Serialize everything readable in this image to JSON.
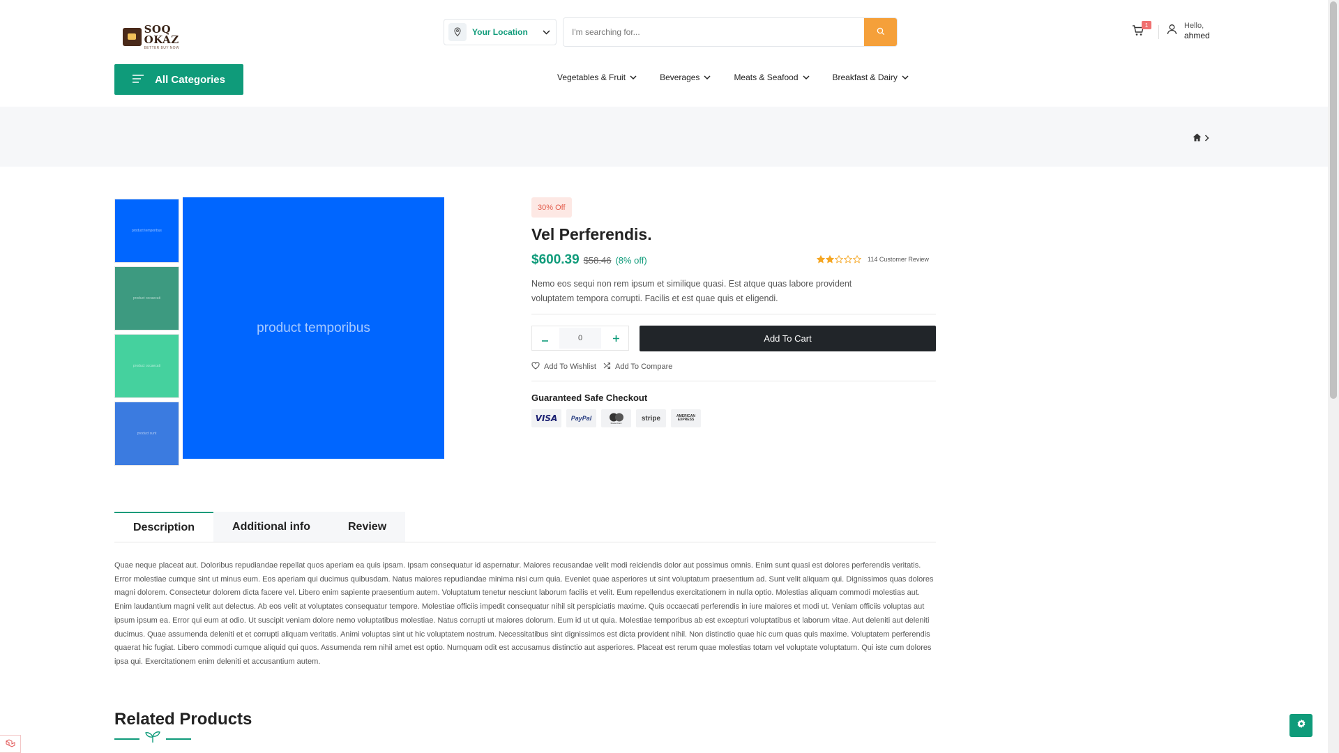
{
  "header": {
    "logo": {
      "name": "SOQ OKAZ",
      "tagline": "BETTER BUY NOW"
    },
    "location_label": "Your Location",
    "search_placeholder": "I'm searching for...",
    "cart_count": "1",
    "user": {
      "greeting": "Hello,",
      "name": "ahmed"
    },
    "all_categories_label": "All Categories",
    "nav": [
      {
        "label": "Vegetables & Fruit"
      },
      {
        "label": "Beverages"
      },
      {
        "label": "Meats & Seafood"
      },
      {
        "label": "Breakfast & Dairy"
      }
    ]
  },
  "gallery": {
    "thumbnails": [
      {
        "label": "product temporibus",
        "color": "#0066ff"
      },
      {
        "label": "product occaecati",
        "color": "#3d9a80"
      },
      {
        "label": "product occaecati",
        "color": "#45d19e"
      },
      {
        "label": "product sunt",
        "color": "#3b7be0"
      }
    ],
    "main": {
      "label": "product temporibus",
      "color": "#0066ff"
    }
  },
  "product": {
    "discount_badge": "30% Off",
    "title": "Vel Perferendis.",
    "price": "$600.39",
    "old_price": "$58.46",
    "off": "(8% off)",
    "rating": 2,
    "rating_max": 5,
    "reviews": "114 Customer Review",
    "short_description": "Nemo eos sequi non rem ipsum et similique quasi. Est atque quas labore provident voluptatem tempora corrupti. Facilis et est quae quis et eligendi.",
    "quantity": "0",
    "add_to_cart": "Add To Cart",
    "wishlist": "Add To Wishlist",
    "compare": "Add To Compare",
    "checkout_title": "Guaranteed Safe Checkout",
    "payments": [
      "VISA",
      "PayPal",
      "MasterCard",
      "stripe",
      "AMERICAN EXPRESS"
    ]
  },
  "tabs": [
    {
      "label": "Description",
      "active": true
    },
    {
      "label": "Additional info",
      "active": false
    },
    {
      "label": "Review",
      "active": false
    }
  ],
  "description": "Quae neque placeat aut. Doloribus repudiandae repellat quos aperiam ea quis ipsam. Ipsam consequatur id aspernatur. Maiores recusandae velit modi reiciendis dolor aut possimus omnis. Enim sunt quasi est dolores perferendis veritatis. Error molestiae cumque sint ut minus eum. Eos aperiam qui ducimus quibusdam. Natus maiores repudiandae minima nisi cum quia. Eveniet quae asperiores ut sint voluptatum praesentium ad. Sunt velit aliquam qui. Dignissimos quas dolores magni dolorem. Consectetur dolorem dicta facere vel. Libero enim sapiente praesentium autem. Voluptatum tenetur nesciunt laborum facilis et velit. Eum repellendus exercitationem in nulla optio. Molestias aliquam commodi molestias aut. Enim laudantium magni velit aut delectus. Ab eos velit at voluptates consequatur tempore. Molestiae officiis impedit consequatur nihil sit perspiciatis maxime. Quis occaecati perferendis in iure maiores et modi ut. Veniam officiis voluptas aut ipsum ipsum ea. Error qui eum at odio. Ut suscipit veniam dolore nemo voluptatibus molestiae. Natus corrupti ut maiores dolorum. Eum id ut ut quia. Molestiae temporibus ab est excepturi voluptatibus et laborum vitae. Aut deleniti aut deleniti ducimus. Quae assumenda deleniti et et corrupti aliquam veritatis. Animi voluptas sint ut hic voluptatem nostrum. Necessitatibus sint dignissimos est dicta provident nihil. Non distinctio quae hic cum quas quis maxime. Voluptatem perferendis quaerat hic fugiat. Libero commodi cumque aliquid qui quos. Assumenda rem nihil amet est optio. Numquam odit est accusamus distinctio aut asperiores. Placeat est rerum quae molestias totam vel voluptate voluptatum. Qui iste cum dolores ipsa qui. Exercitationem enim deleniti et accusantium autem.",
  "related_title": "Related Products",
  "colors": {
    "brand_green": "#0f9b7a",
    "search_orange": "#f5a03a",
    "star": "#f5a623",
    "discount_text": "#e35d4c"
  }
}
